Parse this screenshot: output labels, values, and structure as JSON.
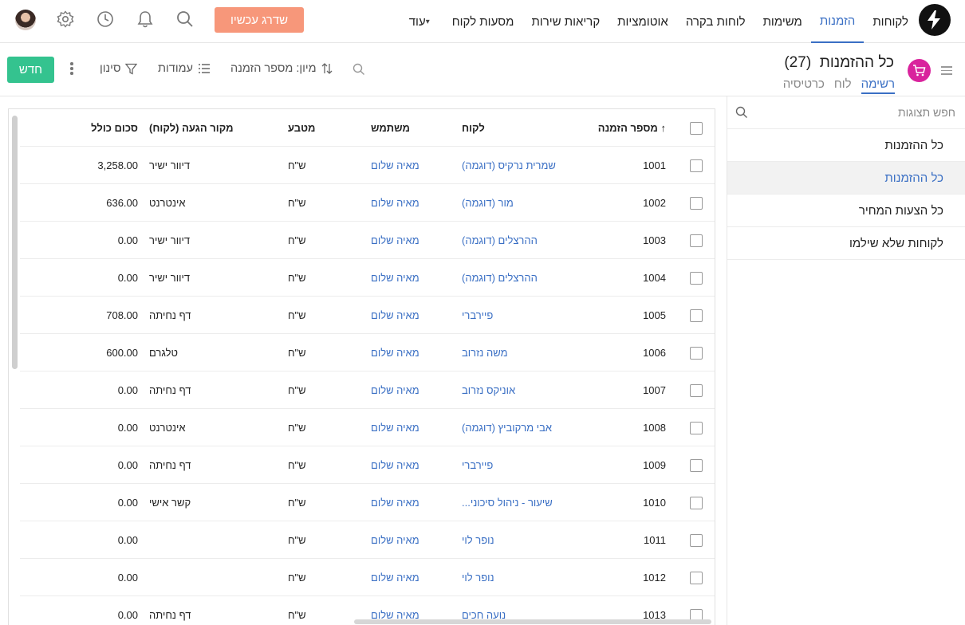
{
  "nav": {
    "tabs": [
      {
        "label": "לקוחות"
      },
      {
        "label": "הזמנות"
      },
      {
        "label": "משימות"
      },
      {
        "label": "לוחות בקרה"
      },
      {
        "label": "אוטומציות"
      },
      {
        "label": "קריאות שירות"
      },
      {
        "label": "מסעות לקוח"
      },
      {
        "label": "עוד"
      }
    ],
    "active_tab": "הזמנות",
    "upgrade_label": "שדרג עכשיו"
  },
  "header": {
    "title": "כל ההזמנות",
    "count": "(27)",
    "view_tabs": [
      {
        "label": "רשימה"
      },
      {
        "label": "לוח"
      },
      {
        "label": "כרטיסיה"
      }
    ],
    "active_view": "רשימה",
    "sort_label": "מיון: מספר הזמנה",
    "columns_label": "עמודות",
    "filter_label": "סינון",
    "new_label": "חדש"
  },
  "sidebar": {
    "search_placeholder": "חפש תצוגות",
    "items": [
      {
        "label": "כל ההזמנות"
      },
      {
        "label": "כל ההזמנות"
      },
      {
        "label": "כל הצעות המחיר"
      },
      {
        "label": "לקוחות שלא שילמו"
      }
    ],
    "active_index": 1
  },
  "table": {
    "columns": {
      "order_number": "מספר הזמנה",
      "sort_arrow": "↑",
      "customer": "לקוח",
      "user": "משתמש",
      "currency": "מטבע",
      "source": "מקור הגעה (לקוח)",
      "total": "סכום כולל"
    },
    "rows": [
      {
        "num": "1001",
        "customer": "שמרית נרקיס (דוגמה)",
        "user": "מאיה שלום",
        "currency": "ש\"ח",
        "source": "דיוור ישיר",
        "total": "3,258.00"
      },
      {
        "num": "1002",
        "customer": "מור (דוגמה)",
        "user": "מאיה שלום",
        "currency": "ש\"ח",
        "source": "אינטרנט",
        "total": "636.00"
      },
      {
        "num": "1003",
        "customer": "ההרצלים (דוגמה)",
        "user": "מאיה שלום",
        "currency": "ש\"ח",
        "source": "דיוור ישיר",
        "total": "0.00"
      },
      {
        "num": "1004",
        "customer": "ההרצלים (דוגמה)",
        "user": "מאיה שלום",
        "currency": "ש\"ח",
        "source": "דיוור ישיר",
        "total": "0.00"
      },
      {
        "num": "1005",
        "customer": "פיירברי",
        "user": "מאיה שלום",
        "currency": "ש\"ח",
        "source": "דף נחיתה",
        "total": "708.00"
      },
      {
        "num": "1006",
        "customer": "משה נזרוב",
        "user": "מאיה שלום",
        "currency": "ש\"ח",
        "source": "טלגרם",
        "total": "600.00"
      },
      {
        "num": "1007",
        "customer": "אוניקס נזרוב",
        "user": "מאיה שלום",
        "currency": "ש\"ח",
        "source": "דף נחיתה",
        "total": "0.00"
      },
      {
        "num": "1008",
        "customer": "אבי מרקוביץ (דוגמה)",
        "user": "מאיה שלום",
        "currency": "ש\"ח",
        "source": "אינטרנט",
        "total": "0.00"
      },
      {
        "num": "1009",
        "customer": "פיירברי",
        "user": "מאיה שלום",
        "currency": "ש\"ח",
        "source": "דף נחיתה",
        "total": "0.00"
      },
      {
        "num": "1010",
        "customer": "שיעור - ניהול סיכוני...",
        "user": "מאיה שלום",
        "currency": "ש\"ח",
        "source": "קשר אישי",
        "total": "0.00"
      },
      {
        "num": "1011",
        "customer": "נופר לוי",
        "user": "מאיה שלום",
        "currency": "ש\"ח",
        "source": "",
        "total": "0.00"
      },
      {
        "num": "1012",
        "customer": "נופר לוי",
        "user": "מאיה שלום",
        "currency": "ש\"ח",
        "source": "",
        "total": "0.00"
      },
      {
        "num": "1013",
        "customer": "נועה חכים",
        "user": "מאיה שלום",
        "currency": "ש\"ח",
        "source": "דף נחיתה",
        "total": "0.00"
      }
    ]
  },
  "colors": {
    "accent": "#3a6fc4",
    "upgrade": "#f7977a",
    "new_button": "#34c38f",
    "cart_badge": "#d9239d"
  },
  "icons": [
    "logo-icon",
    "chevron-down-icon",
    "search-icon",
    "bell-icon",
    "clock-icon",
    "gear-icon",
    "avatar",
    "menu-icon",
    "cart-icon",
    "sort-icon",
    "columns-icon",
    "filter-icon",
    "kebab-icon"
  ]
}
